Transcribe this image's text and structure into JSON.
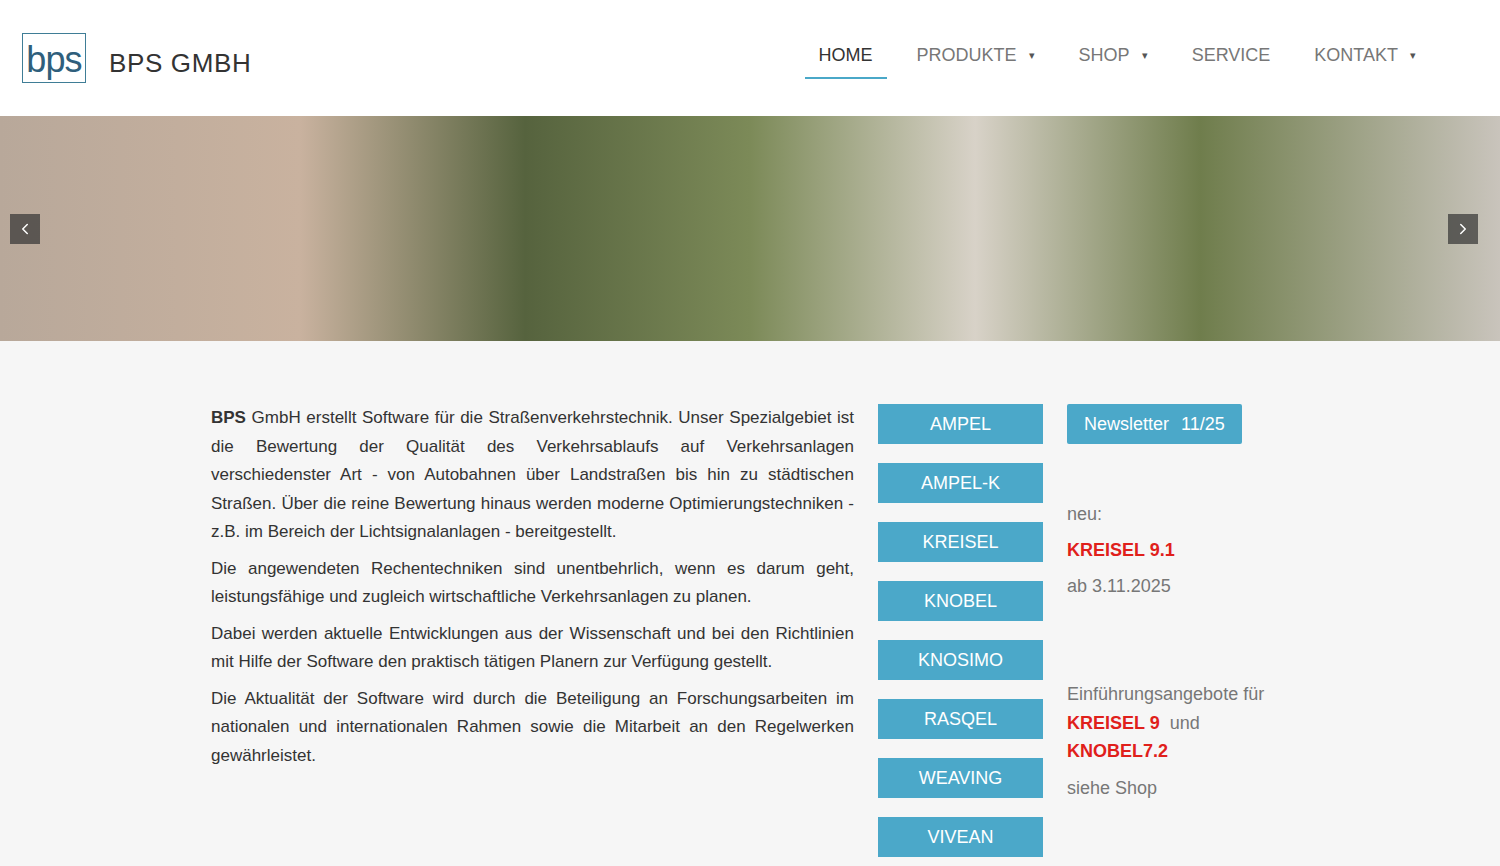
{
  "header": {
    "logo": "bps",
    "company": "BPS GMBH",
    "nav": [
      {
        "label": "HOME",
        "selected": true,
        "dropdown": false
      },
      {
        "label": "PRODUKTE",
        "selected": false,
        "dropdown": true,
        "arrow": "▾"
      },
      {
        "label": "SHOP",
        "selected": false,
        "dropdown": true,
        "arrow": "▾"
      },
      {
        "label": "SERVICE",
        "selected": false,
        "dropdown": false
      },
      {
        "label": "KONTAKT",
        "selected": false,
        "dropdown": true,
        "arrow": "▾"
      }
    ]
  },
  "carousel": {
    "has_prev": true,
    "has_next": true
  },
  "intro": {
    "paragraphs": [
      {
        "bold": "BPS",
        "text": " GmbH erstellt Software für die Straßenverkehrstechnik. Unser Spezialgebiet ist die Bewertung der Qualität des Verkehrsablaufs auf Verkehrsanlagen verschiedenster Art - von Autobahnen über Landstraßen bis hin zu städtischen Straßen. Über die reine Bewertung hinaus werden moderne Optimierungstechniken - z.B. im Bereich der Lichtsignalanlagen - bereitgestellt."
      },
      {
        "bold": "",
        "text": "Die angewendeten Rechentechniken sind unentbehrlich, wenn es darum geht, leistungsfähige und zugleich wirtschaftliche Verkehrsanlagen zu planen."
      },
      {
        "bold": "",
        "text": "Dabei werden aktuelle Entwicklungen aus der  Wissenschaft und bei den  Richtlinien mit Hilfe der Software den praktisch tätigen Planern  zur Verfügung gestellt."
      },
      {
        "bold": "",
        "text": "Die Aktualität der Software wird durch die Beteiligung an Forschungsarbeiten im nationalen und internationalen Rahmen sowie die Mitarbeit an den Regelwerken gewährleistet."
      }
    ]
  },
  "products": [
    "AMPEL",
    "AMPEL-K",
    "KREISEL",
    "KNOBEL",
    "KNOSIMO",
    "RASQEL",
    "WEAVING",
    "VIVEAN"
  ],
  "sidebar": {
    "newsletter": {
      "label": "Newsletter",
      "issue": "11/25"
    },
    "new_label": "neu:",
    "new_product": "KREISEL 9.1",
    "new_date": "ab 3.11.2025",
    "offer": [
      {
        "text": "Einführungsangebote für ",
        "highlight": false
      },
      {
        "text": "KREISEL 9",
        "highlight": true
      },
      {
        "text": "  und ",
        "highlight": false
      },
      {
        "text": "KNOBEL7.2",
        "highlight": true
      }
    ],
    "offer_footer": "siehe Shop"
  }
}
